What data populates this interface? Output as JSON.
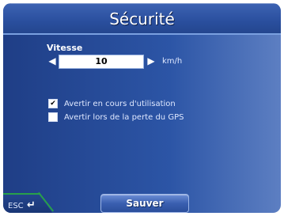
{
  "header": {
    "title": "Sécurité"
  },
  "speed": {
    "label": "Vitesse",
    "value": "10",
    "unit": "km/h",
    "decrease_icon": "left-arrow",
    "increase_icon": "right-arrow"
  },
  "options": [
    {
      "label": "Avertir en cours d'utilisation",
      "checked": true,
      "mark": "✔"
    },
    {
      "label": "Avertir lors de la perte du GPS",
      "checked": false,
      "mark": ""
    }
  ],
  "footer": {
    "esc_label": "ESC",
    "return_icon": "return-arrow",
    "save_label": "Sauver"
  },
  "colors": {
    "background": "#2c55a6",
    "titlebar": "#2a4f9e",
    "esc_accent": "#28a04a"
  }
}
